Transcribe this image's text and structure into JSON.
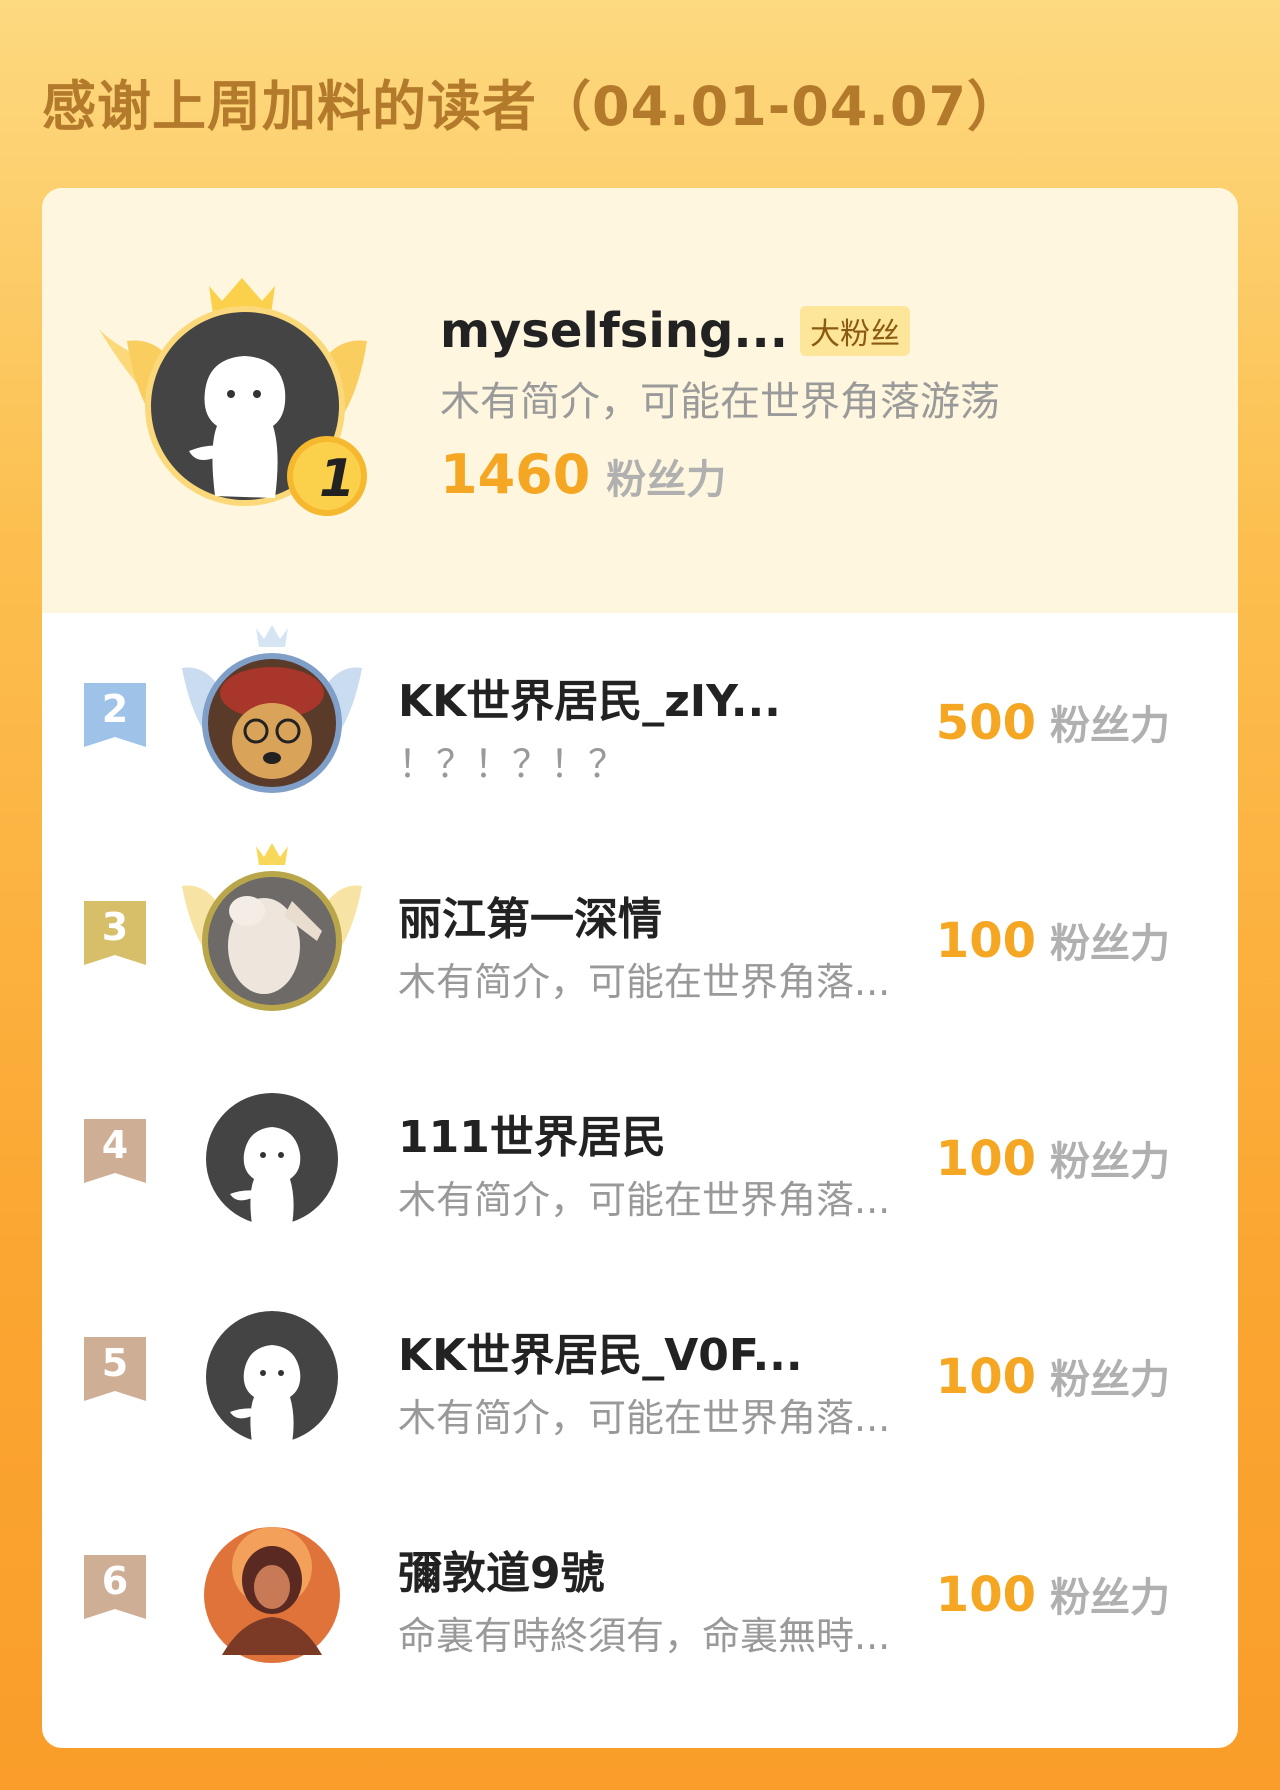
{
  "header": {
    "title": "感谢上周加料的读者（04.01-04.07）"
  },
  "colors": {
    "accent": "#f5a623",
    "title": "#b47a2c",
    "silver": "#8fb6df",
    "gold": "#d8bc60",
    "bronze": "#c9a48a"
  },
  "first": {
    "rank": "1",
    "name": "myselfsing...",
    "tag": "大粉丝",
    "intro": "木有简介，可能在世界角落游荡",
    "score": "1460",
    "unit": "粉丝力",
    "avatar": "default-avatar-icon"
  },
  "readers": [
    {
      "rank": "2",
      "name": "KK世界居民_zIY...",
      "intro": "！？！？！？",
      "score": "500",
      "unit": "粉丝力",
      "avatar": "dog-photo-avatar"
    },
    {
      "rank": "3",
      "name": "丽江第一深情",
      "intro": "木有简介，可能在世界角落...",
      "score": "100",
      "unit": "粉丝力",
      "avatar": "cat-photo-avatar"
    },
    {
      "rank": "4",
      "name": "111世界居民",
      "intro": "木有简介，可能在世界角落...",
      "score": "100",
      "unit": "粉丝力",
      "avatar": "default-avatar-icon"
    },
    {
      "rank": "5",
      "name": "KK世界居民_V0F...",
      "intro": "木有简介，可能在世界角落...",
      "score": "100",
      "unit": "粉丝力",
      "avatar": "default-avatar-icon"
    },
    {
      "rank": "6",
      "name": "彌敦道9號",
      "intro": "命裏有時終須有，命裏無時...",
      "score": "100",
      "unit": "粉丝力",
      "avatar": "person-photo-avatar"
    }
  ]
}
